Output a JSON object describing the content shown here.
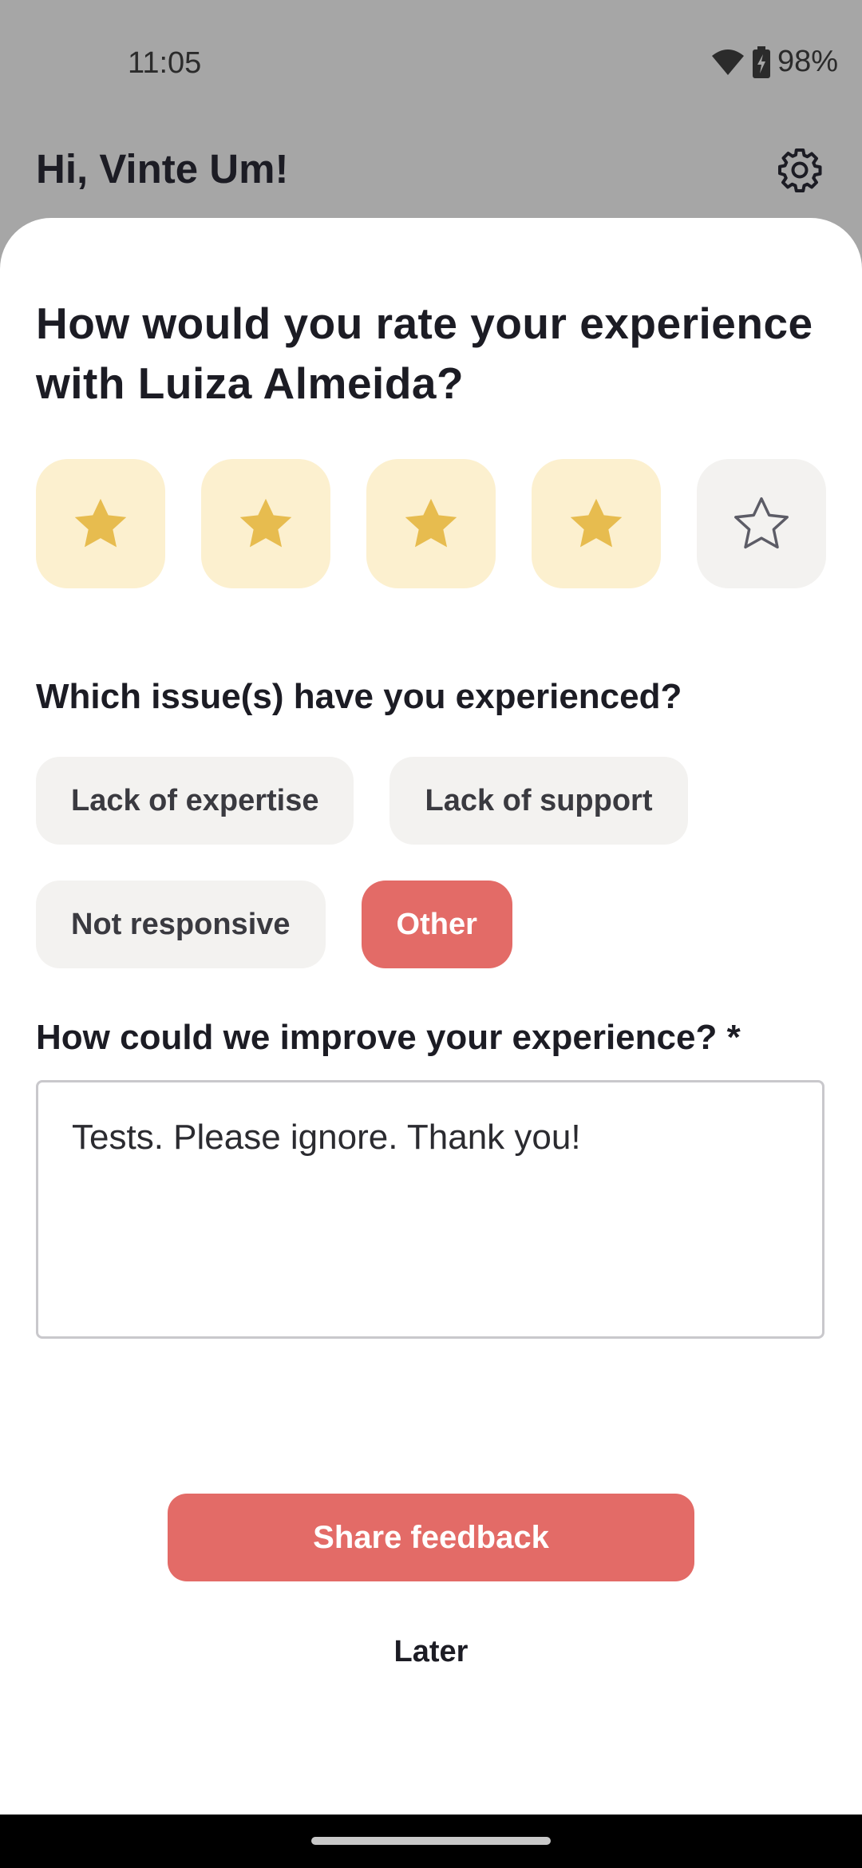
{
  "status_bar": {
    "time": "11:05",
    "battery": "98%"
  },
  "header": {
    "greeting": "Hi, Vinte Um!"
  },
  "sheet": {
    "question": "How would you rate your experience with Luiza Almeida?",
    "rating": {
      "value": 4,
      "max": 5
    },
    "issues_title": "Which issue(s) have you experienced?",
    "issues": [
      {
        "label": "Lack of expertise",
        "selected": false
      },
      {
        "label": "Lack of support",
        "selected": false
      },
      {
        "label": "Not responsive",
        "selected": false
      },
      {
        "label": "Other",
        "selected": true
      }
    ],
    "improve_title": "How could we improve your experience? *",
    "improve_value": "Tests. Please ignore. Thank you!",
    "share_label": "Share feedback",
    "later_label": "Later"
  },
  "colors": {
    "accent": "#e36b67",
    "star_filled": "#e7bc4f",
    "star_box_filled": "#fcf0cf",
    "star_box_empty": "#f3f2f0",
    "scrim": "#a6a6a6"
  },
  "icons": [
    "wifi-icon",
    "battery-icon",
    "gear-icon",
    "star-icon"
  ]
}
